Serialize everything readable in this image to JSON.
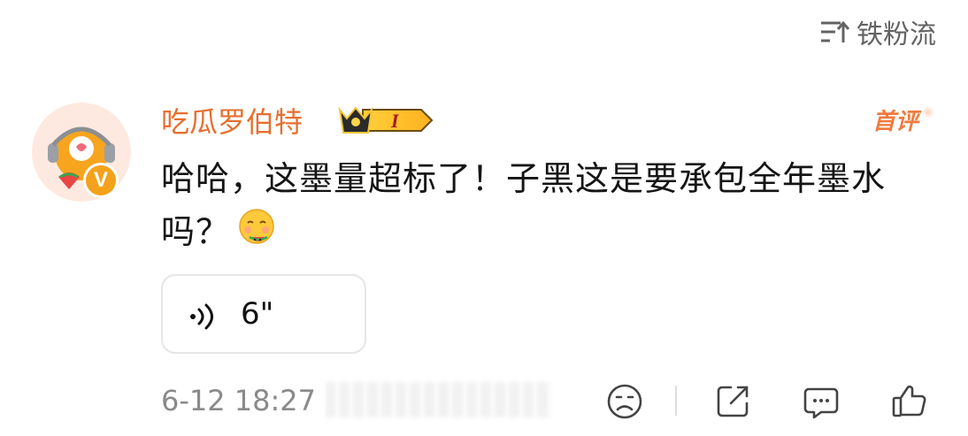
{
  "sort": {
    "label": "铁粉流",
    "icon": "sort-lines-icon"
  },
  "comment": {
    "username": "吃瓜罗伯特",
    "member_badge_level": "I",
    "first_comment_label": "首评",
    "verified_mark": "V",
    "text": "哈哈，这墨量超标了！子黑这是要承包全年墨水吗？",
    "emoji": "eating-watermelon-emoji",
    "voice": {
      "duration": "6\"",
      "icon": "voice-wave-icon"
    },
    "timestamp": "6-12 18:27",
    "actions": [
      "dislike-face-icon",
      "share-icon",
      "reply-icon",
      "like-icon"
    ]
  },
  "colors": {
    "username": "#e66f2f",
    "badge_orange": "#f4a21c",
    "text": "#151515",
    "meta": "#8a8a8a"
  }
}
